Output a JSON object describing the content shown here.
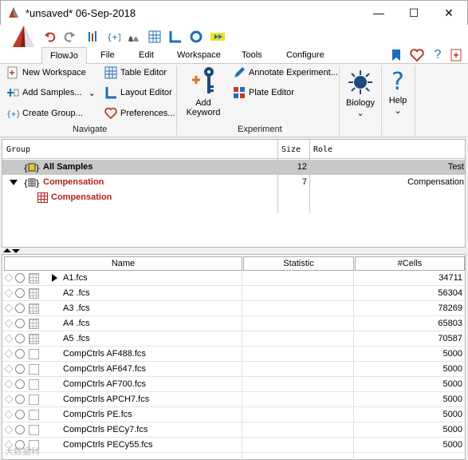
{
  "window": {
    "title": "*unsaved* 06-Sep-2018",
    "minimize": "—",
    "maximize": "☐",
    "close": "✕"
  },
  "tabs": [
    "FlowJo",
    "File",
    "Edit",
    "Workspace",
    "Tools",
    "Configure"
  ],
  "ribbon": {
    "navigate": {
      "items": [
        "New Workspace",
        "Add Samples...",
        "Create Group...",
        "Table Editor",
        "Layout Editor",
        "Preferences..."
      ],
      "label": "Navigate"
    },
    "experiment": {
      "add_keyword": "Add\nKeyword",
      "add_keyword_line1": "Add",
      "add_keyword_line2": "Keyword",
      "items": [
        "Annotate Experiment...",
        "Plate Editor"
      ],
      "label": "Experiment"
    },
    "biology": "Biology",
    "help": "Help"
  },
  "groups": {
    "columns": [
      "Group",
      "Size",
      "Role"
    ],
    "rows": [
      {
        "name": "All Samples",
        "size": "12",
        "role": "Test"
      },
      {
        "name": "Compensation",
        "size": "7",
        "role": "Compensation"
      },
      {
        "name": "Compensation",
        "size": "",
        "role": ""
      }
    ]
  },
  "samples": {
    "columns": [
      "Name",
      "Statistic",
      "#Cells"
    ],
    "rows": [
      {
        "name": "A1.fcs",
        "statistic": "",
        "cells": "34711"
      },
      {
        "name": "A2 .fcs",
        "statistic": "",
        "cells": "56304"
      },
      {
        "name": "A3 .fcs",
        "statistic": "",
        "cells": "78269"
      },
      {
        "name": "A4 .fcs",
        "statistic": "",
        "cells": "65803"
      },
      {
        "name": "A5 .fcs",
        "statistic": "",
        "cells": "70587"
      },
      {
        "name": "CompCtrls AF488.fcs",
        "statistic": "",
        "cells": "5000"
      },
      {
        "name": "CompCtrls AF647.fcs",
        "statistic": "",
        "cells": "5000"
      },
      {
        "name": "CompCtrls AF700.fcs",
        "statistic": "",
        "cells": "5000"
      },
      {
        "name": "CompCtrls APCH7.fcs",
        "statistic": "",
        "cells": "5000"
      },
      {
        "name": "CompCtrls PE.fcs",
        "statistic": "",
        "cells": "5000"
      },
      {
        "name": "CompCtrls PECy7.fcs",
        "statistic": "",
        "cells": "5000"
      },
      {
        "name": "CompCtrls PECy55.fcs",
        "statistic": "",
        "cells": "5000"
      }
    ]
  },
  "watermark": "大数据科",
  "colors": {
    "compensation_red": "#b22222",
    "selected_row": "#c8c8c8",
    "accent_blue": "#1e6fb5"
  }
}
